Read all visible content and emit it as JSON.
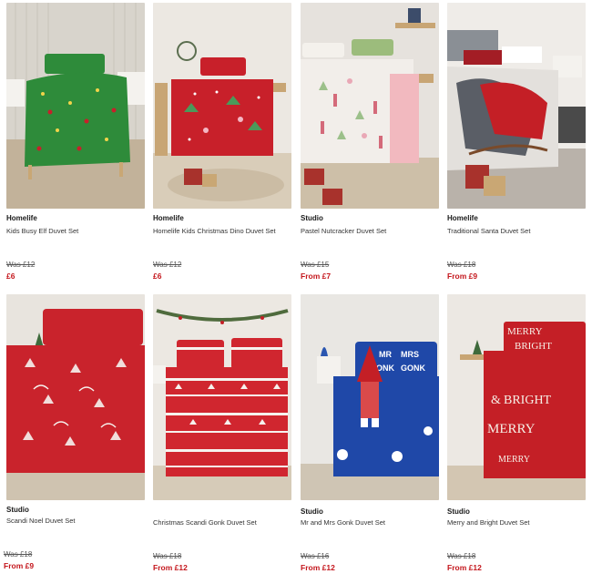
{
  "products": [
    {
      "brand": "Homelife",
      "name": "Kids Busy Elf Duvet Set",
      "was": "Was  £12",
      "price": "£6",
      "image": {
        "bed": "#2e8b3a",
        "wall": "#d8d4cc",
        "pattern": "elf",
        "rug": "#c9b8a0"
      }
    },
    {
      "brand": "Homelife",
      "name": "Homelife Kids Christmas Dino Duvet Set",
      "was": "Was  £12",
      "price": "£6",
      "image": {
        "bed": "#c8202a",
        "wall": "#ece8e2",
        "pattern": "dino",
        "rug": "#d7c9b2"
      }
    },
    {
      "brand": "Studio",
      "name": "Pastel Nutcracker Duvet Set",
      "was": "Was  £15",
      "price": "From £7",
      "image": {
        "bed": "#f2eeea",
        "wall": "#e6e2dd",
        "pattern": "nutcracker",
        "rug": "#cdbfa8"
      }
    },
    {
      "brand": "Homelife",
      "name": "Traditional Santa Duvet Set",
      "was": "Was  £18",
      "price": "From £9",
      "image": {
        "bed": "#e3e0dc",
        "wall": "#efece8",
        "pattern": "santa",
        "rug": "#b9b2aa"
      }
    },
    {
      "brand": "Studio",
      "name": "Scandi Noel Duvet Set",
      "was": "Was  £18",
      "price": "From £9",
      "image": {
        "bed": "#c9232c",
        "wall": "#e8e4de",
        "pattern": "scandi",
        "rug": "#cfc3b0"
      }
    },
    {
      "brand": "",
      "name": "Christmas Scandi Gonk Duvet Set",
      "was": "Was  £18",
      "price": "From £12",
      "image": {
        "bed": "#d0262f",
        "wall": "#ece8e2",
        "pattern": "fairisle",
        "rug": "#d6cbb8"
      }
    },
    {
      "brand": "Studio",
      "name": "Mr and Mrs Gonk Duvet Set",
      "was": "Was  £16",
      "price": "From £12",
      "image": {
        "bed": "#1f48a8",
        "wall": "#e9e7e3",
        "pattern": "gonk",
        "rug": "#cfc5b4",
        "label_left": "MR",
        "label_right": "MRS",
        "label_word": "GONK"
      }
    },
    {
      "brand": "Studio",
      "name": "Merry and Bright Duvet Set",
      "was": "Was  £18",
      "price": "From £12",
      "image": {
        "bed": "#c41f26",
        "wall": "#ece8e3",
        "pattern": "merry",
        "rug": "#d3c6b2",
        "label_words": [
          "MERRY",
          "&",
          "BRIGHT"
        ]
      }
    }
  ]
}
